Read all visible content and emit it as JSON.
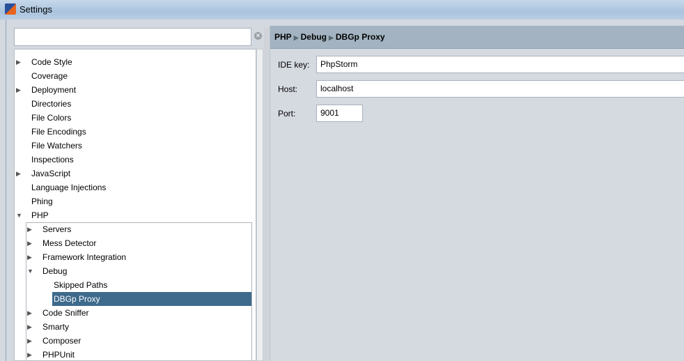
{
  "window": {
    "title": "Settings"
  },
  "search": {
    "value": "",
    "clear_icon": "clear-icon"
  },
  "tree": {
    "items": [
      {
        "label": "Code Style",
        "level": 0,
        "arrow": "right"
      },
      {
        "label": "Coverage",
        "level": 0,
        "arrow": ""
      },
      {
        "label": "Deployment",
        "level": 0,
        "arrow": "right"
      },
      {
        "label": "Directories",
        "level": 0,
        "arrow": ""
      },
      {
        "label": "File Colors",
        "level": 0,
        "arrow": ""
      },
      {
        "label": "File Encodings",
        "level": 0,
        "arrow": ""
      },
      {
        "label": "File Watchers",
        "level": 0,
        "arrow": ""
      },
      {
        "label": "Inspections",
        "level": 0,
        "arrow": ""
      },
      {
        "label": "JavaScript",
        "level": 0,
        "arrow": "right"
      },
      {
        "label": "Language Injections",
        "level": 0,
        "arrow": ""
      },
      {
        "label": "Phing",
        "level": 0,
        "arrow": ""
      },
      {
        "label": "PHP",
        "level": 0,
        "arrow": "down"
      },
      {
        "label": "Servers",
        "level": 1,
        "arrow": "right"
      },
      {
        "label": "Mess Detector",
        "level": 1,
        "arrow": "right"
      },
      {
        "label": "Framework Integration",
        "level": 1,
        "arrow": "right"
      },
      {
        "label": "Debug",
        "level": 1,
        "arrow": "down"
      },
      {
        "label": "Skipped Paths",
        "level": 2,
        "arrow": ""
      },
      {
        "label": "DBGp Proxy",
        "level": 2,
        "arrow": "",
        "selected": true
      },
      {
        "label": "Code Sniffer",
        "level": 1,
        "arrow": "right"
      },
      {
        "label": "Smarty",
        "level": 1,
        "arrow": "right"
      },
      {
        "label": "Composer",
        "level": 1,
        "arrow": "right"
      },
      {
        "label": "PHPUnit",
        "level": 1,
        "arrow": "right"
      }
    ]
  },
  "breadcrumb": [
    "PHP",
    "Debug",
    "DBGp Proxy"
  ],
  "form": {
    "ide_key": {
      "label": "IDE key:",
      "value": "PhpStorm"
    },
    "host": {
      "label": "Host:",
      "value": "localhost"
    },
    "port": {
      "label": "Port:",
      "value": "9001"
    }
  },
  "colors": {
    "selection": "#3e6a8c",
    "header": "#a3b3c1"
  }
}
